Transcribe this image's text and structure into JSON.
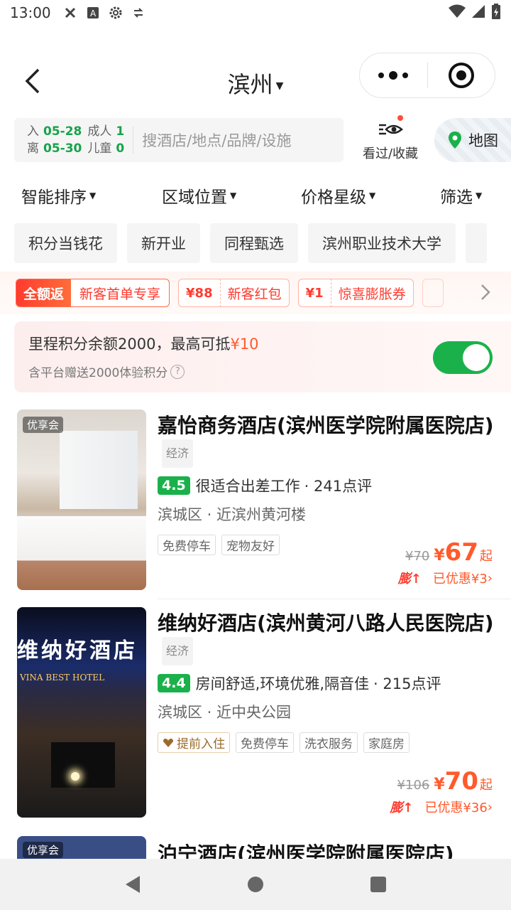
{
  "status_bar": {
    "time": "13:00"
  },
  "header": {
    "city": "滨州"
  },
  "search": {
    "checkin_label": "入",
    "checkin_date": "05-28",
    "checkout_label": "离",
    "checkout_date": "05-30",
    "adult_label": "成人",
    "adult_count": "1",
    "child_label": "儿童",
    "child_count": "0",
    "placeholder": "搜酒店/地点/品牌/设施",
    "history_label": "看过/收藏",
    "map_label": "地图"
  },
  "sort": [
    "智能排序",
    "区域位置",
    "价格星级",
    "筛选"
  ],
  "chips": [
    "积分当钱花",
    "新开业",
    "同程甄选",
    "滨州职业技术大学"
  ],
  "coupons": {
    "full_tag": "全额返",
    "full_text": "新客首单专享",
    "items": [
      {
        "amount": "¥88",
        "text": "新客红包"
      },
      {
        "amount": "¥1",
        "text": "惊喜膨胀券"
      }
    ]
  },
  "points": {
    "main_prefix": "里程积分余额2000，最高可抵",
    "main_value": "¥10",
    "sub": "含平台赠送2000体验积分",
    "toggle_on": true
  },
  "hotels": [
    {
      "badge": "优享会",
      "name": "嘉怡商务酒店(滨州医学院附属医院店)",
      "level": "经济",
      "score": "4.5",
      "comment": "很适合出差工作",
      "reviews": "· 241点评",
      "location": "滨城区 · 近滨州黄河楼",
      "tags": [
        "免费停车",
        "宠物友好"
      ],
      "orig_price": "¥70",
      "yen": "¥",
      "price": "67",
      "qi": "起",
      "discount": "已优惠¥3",
      "discount_icon": "膨↑"
    },
    {
      "name": "维纳好酒店(滨州黄河八路人民医院店)",
      "level": "经济",
      "score": "4.4",
      "comment": "房间舒适,环境优雅,隔音佳",
      "reviews": "· 215点评",
      "location": "滨城区 · 近中央公园",
      "early_tag": "提前入住",
      "tags": [
        "免费停车",
        "洗衣服务",
        "家庭房"
      ],
      "orig_price": "¥106",
      "yen": "¥",
      "price": "70",
      "qi": "起",
      "discount": "已优惠¥36",
      "discount_icon": "膨↑",
      "sign": "维纳好酒店",
      "sign_en": "VINA BEST HOTEL"
    }
  ],
  "peek": {
    "badge": "优享会",
    "name": "泊宁酒店(滨州医学院附属医院店)"
  },
  "colors": {
    "accent_green": "#1ab14b",
    "price_orange": "#ff5a2c",
    "coupon_red": "#ff3b2f"
  }
}
